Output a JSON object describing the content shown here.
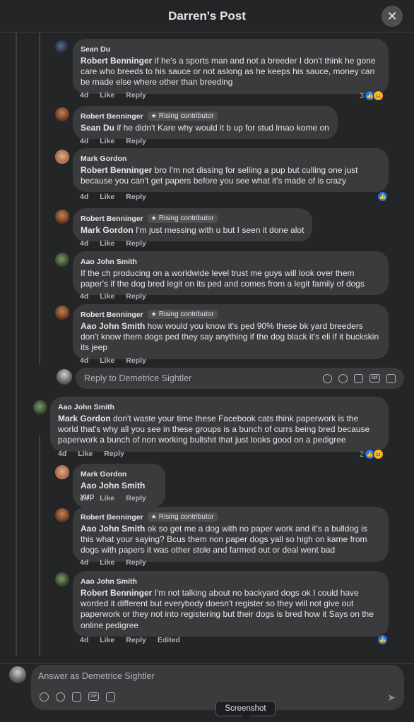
{
  "header": {
    "title": "Darren's Post",
    "close_glyph": "✕"
  },
  "badge_label": "Rising contributor",
  "actions": {
    "like": "Like",
    "reply": "Reply"
  },
  "comments": [
    {
      "author": "Sean Du",
      "mention": "Robert Benninger",
      "text": " if he's a sports man and not a breeder I don't think he gone care who breeds to his sauce or not aslong as he keeps his sauce, money can be made else where other than breeding",
      "time": "4d",
      "reactions": "3"
    },
    {
      "author": "Robert Benninger",
      "mention": "Sean Du",
      "text": " if he didn't Kare why would it b up for stud lmao kome on",
      "time": "4d"
    },
    {
      "author": "Mark Gordon",
      "mention": "Robert Benninger",
      "text": " bro I'm not dissing for selling a pup but culling one just because you can't get papers before you see what it's made of is crazy",
      "time": "4d"
    },
    {
      "author": "Robert Benninger",
      "mention": "Mark Gordon",
      "text": " I'm just messing with u but I seen it done alot",
      "time": "4d"
    },
    {
      "author": "Aao John Smith",
      "mention": "",
      "text": "If the ch producing on a worldwide level trust me guys will look over them paper's if the dog bred legit on its ped and comes from a legit family of dogs",
      "time": "4d"
    },
    {
      "author": "Robert Benninger",
      "mention": "Aao John Smith",
      "text": " how would you know it's ped 90% these bk yard breeders don't know them dogs ped they say anything if the dog black it's eli if it buckskin its jeep",
      "time": "4d"
    },
    {
      "author": "Aao John Smith",
      "mention": "Mark Gordon",
      "text": " don't waste your time these Facebook cats think paperwork is the world that's why all you see in these groups is a bunch of currs being bred because paperwork a bunch of non working bullshit that just looks good on a pedigree",
      "time": "4d",
      "reactions": "2"
    },
    {
      "author": "Mark Gordon",
      "mention": "Aao John Smith",
      "text": " yup",
      "time": "4d"
    },
    {
      "author": "Robert Benninger",
      "mention": "Aao John Smith",
      "text": " ok so get me a dog with no paper work and it's a bulldog is this what your saying? Bcus them non paper dogs yall so high on kame from dogs with papers it was other stole and farmed out or deal went bad",
      "time": "4d"
    },
    {
      "author": "Aao John Smith",
      "mention": "Robert Benninger",
      "text": " I'm not talking about no backyard dogs ok I could have worded it different but everybody doesn't register so they will not give out paperwork or they not into registering but their dogs is bred how it Says on the online pedigree",
      "time": "4d",
      "edited": "Edited"
    }
  ],
  "reply_box": {
    "placeholder": "Reply to Demetrice Sightler"
  },
  "composer": {
    "placeholder": "Answer as Demetrice Sightler"
  },
  "tooltip": {
    "text": "Screenshot"
  },
  "icons": [
    "close-icon",
    "like-reaction-icon",
    "haha-reaction-icon",
    "avatar-sticker-icon",
    "emoji-icon",
    "camera-icon",
    "gif-icon",
    "sticker-icon",
    "send-icon"
  ]
}
